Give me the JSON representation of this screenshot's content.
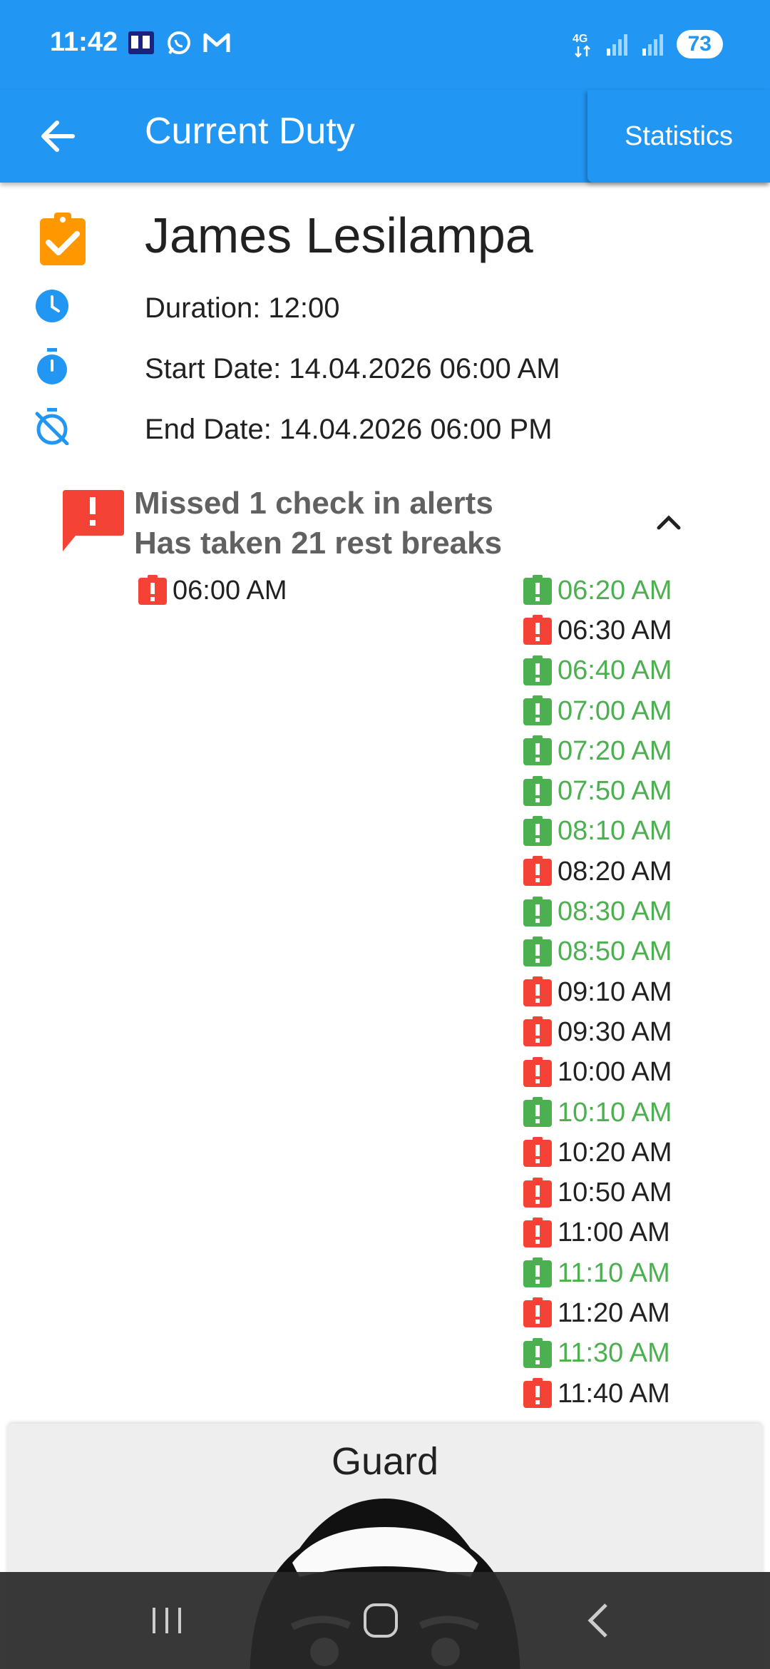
{
  "status_bar": {
    "time": "11:42",
    "network": "4G",
    "battery": "73",
    "notification_icons": [
      "mobilis-app-icon",
      "whatsapp-icon",
      "gmail-icon"
    ]
  },
  "app_bar": {
    "title": "Current Duty",
    "statistics_label": "Statistics"
  },
  "duty": {
    "name": "James Lesilampa",
    "duration": "Duration: 12:00",
    "start_date": "Start Date: 14.04.2026 06:00 AM",
    "end_date": "End Date: 14.04.2026 06:00 PM"
  },
  "alerts": {
    "missed_label": "Missed 1 check in alerts",
    "rest_label": "Has taken 21 rest breaks",
    "check_ins": [
      {
        "time": "06:00 AM",
        "status": "missed"
      }
    ],
    "rest_breaks": [
      {
        "time": "06:20 AM",
        "status": "ok"
      },
      {
        "time": "06:30 AM",
        "status": "missed"
      },
      {
        "time": "06:40 AM",
        "status": "ok"
      },
      {
        "time": "07:00 AM",
        "status": "ok"
      },
      {
        "time": "07:20 AM",
        "status": "ok"
      },
      {
        "time": "07:50 AM",
        "status": "ok"
      },
      {
        "time": "08:10 AM",
        "status": "ok"
      },
      {
        "time": "08:20 AM",
        "status": "missed"
      },
      {
        "time": "08:30 AM",
        "status": "ok"
      },
      {
        "time": "08:50 AM",
        "status": "ok"
      },
      {
        "time": "09:10 AM",
        "status": "missed"
      },
      {
        "time": "09:30 AM",
        "status": "missed"
      },
      {
        "time": "10:00 AM",
        "status": "missed"
      },
      {
        "time": "10:10 AM",
        "status": "ok"
      },
      {
        "time": "10:20 AM",
        "status": "missed"
      },
      {
        "time": "10:50 AM",
        "status": "missed"
      },
      {
        "time": "11:00 AM",
        "status": "missed"
      },
      {
        "time": "11:10 AM",
        "status": "ok"
      },
      {
        "time": "11:20 AM",
        "status": "missed"
      },
      {
        "time": "11:30 AM",
        "status": "ok"
      },
      {
        "time": "11:40 AM",
        "status": "missed"
      }
    ]
  },
  "guard_card": {
    "label": "Guard"
  },
  "colors": {
    "primary": "#2196f3",
    "accent_orange": "#ff9800",
    "alert_red": "#f44336",
    "ok_green": "#4caf50",
    "muted_text": "#616161"
  }
}
